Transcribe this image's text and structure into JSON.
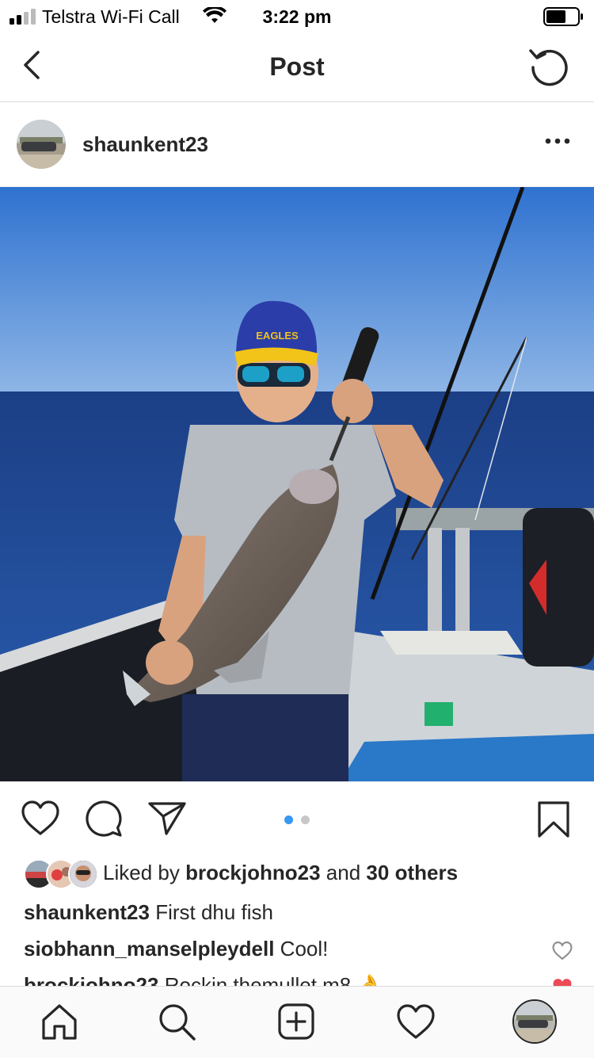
{
  "status_bar": {
    "carrier": "Telstra Wi-Fi Call",
    "time": "3:22 pm"
  },
  "nav": {
    "title": "Post"
  },
  "post": {
    "username": "shaunkent23",
    "likes": {
      "prefix": "Liked by",
      "liker": "brockjohno23",
      "joiner": "and",
      "others": "30 others"
    },
    "caption": {
      "user": "shaunkent23",
      "text": "First dhu fish"
    },
    "comments": [
      {
        "user": "siobhann_manselpleydell",
        "text": "Cool!",
        "liked": false
      },
      {
        "user": "brockjohno23",
        "text": "Rockin themullet m8 👌",
        "liked": true
      }
    ],
    "carousel": {
      "count": 2,
      "active": 0
    }
  },
  "colors": {
    "accent": "#3897f0",
    "heart_red": "#ed4956",
    "text": "#262626",
    "divider": "#dbdbdb"
  },
  "icons": {
    "back": "chevron-left-icon",
    "refresh": "refresh-icon",
    "more": "more-dots-icon",
    "like": "heart-icon",
    "comment": "comment-bubble-icon",
    "share": "paper-plane-icon",
    "save": "bookmark-icon",
    "tabs": [
      "home-icon",
      "search-icon",
      "new-post-icon",
      "activity-heart-icon",
      "profile-avatar-icon"
    ]
  }
}
